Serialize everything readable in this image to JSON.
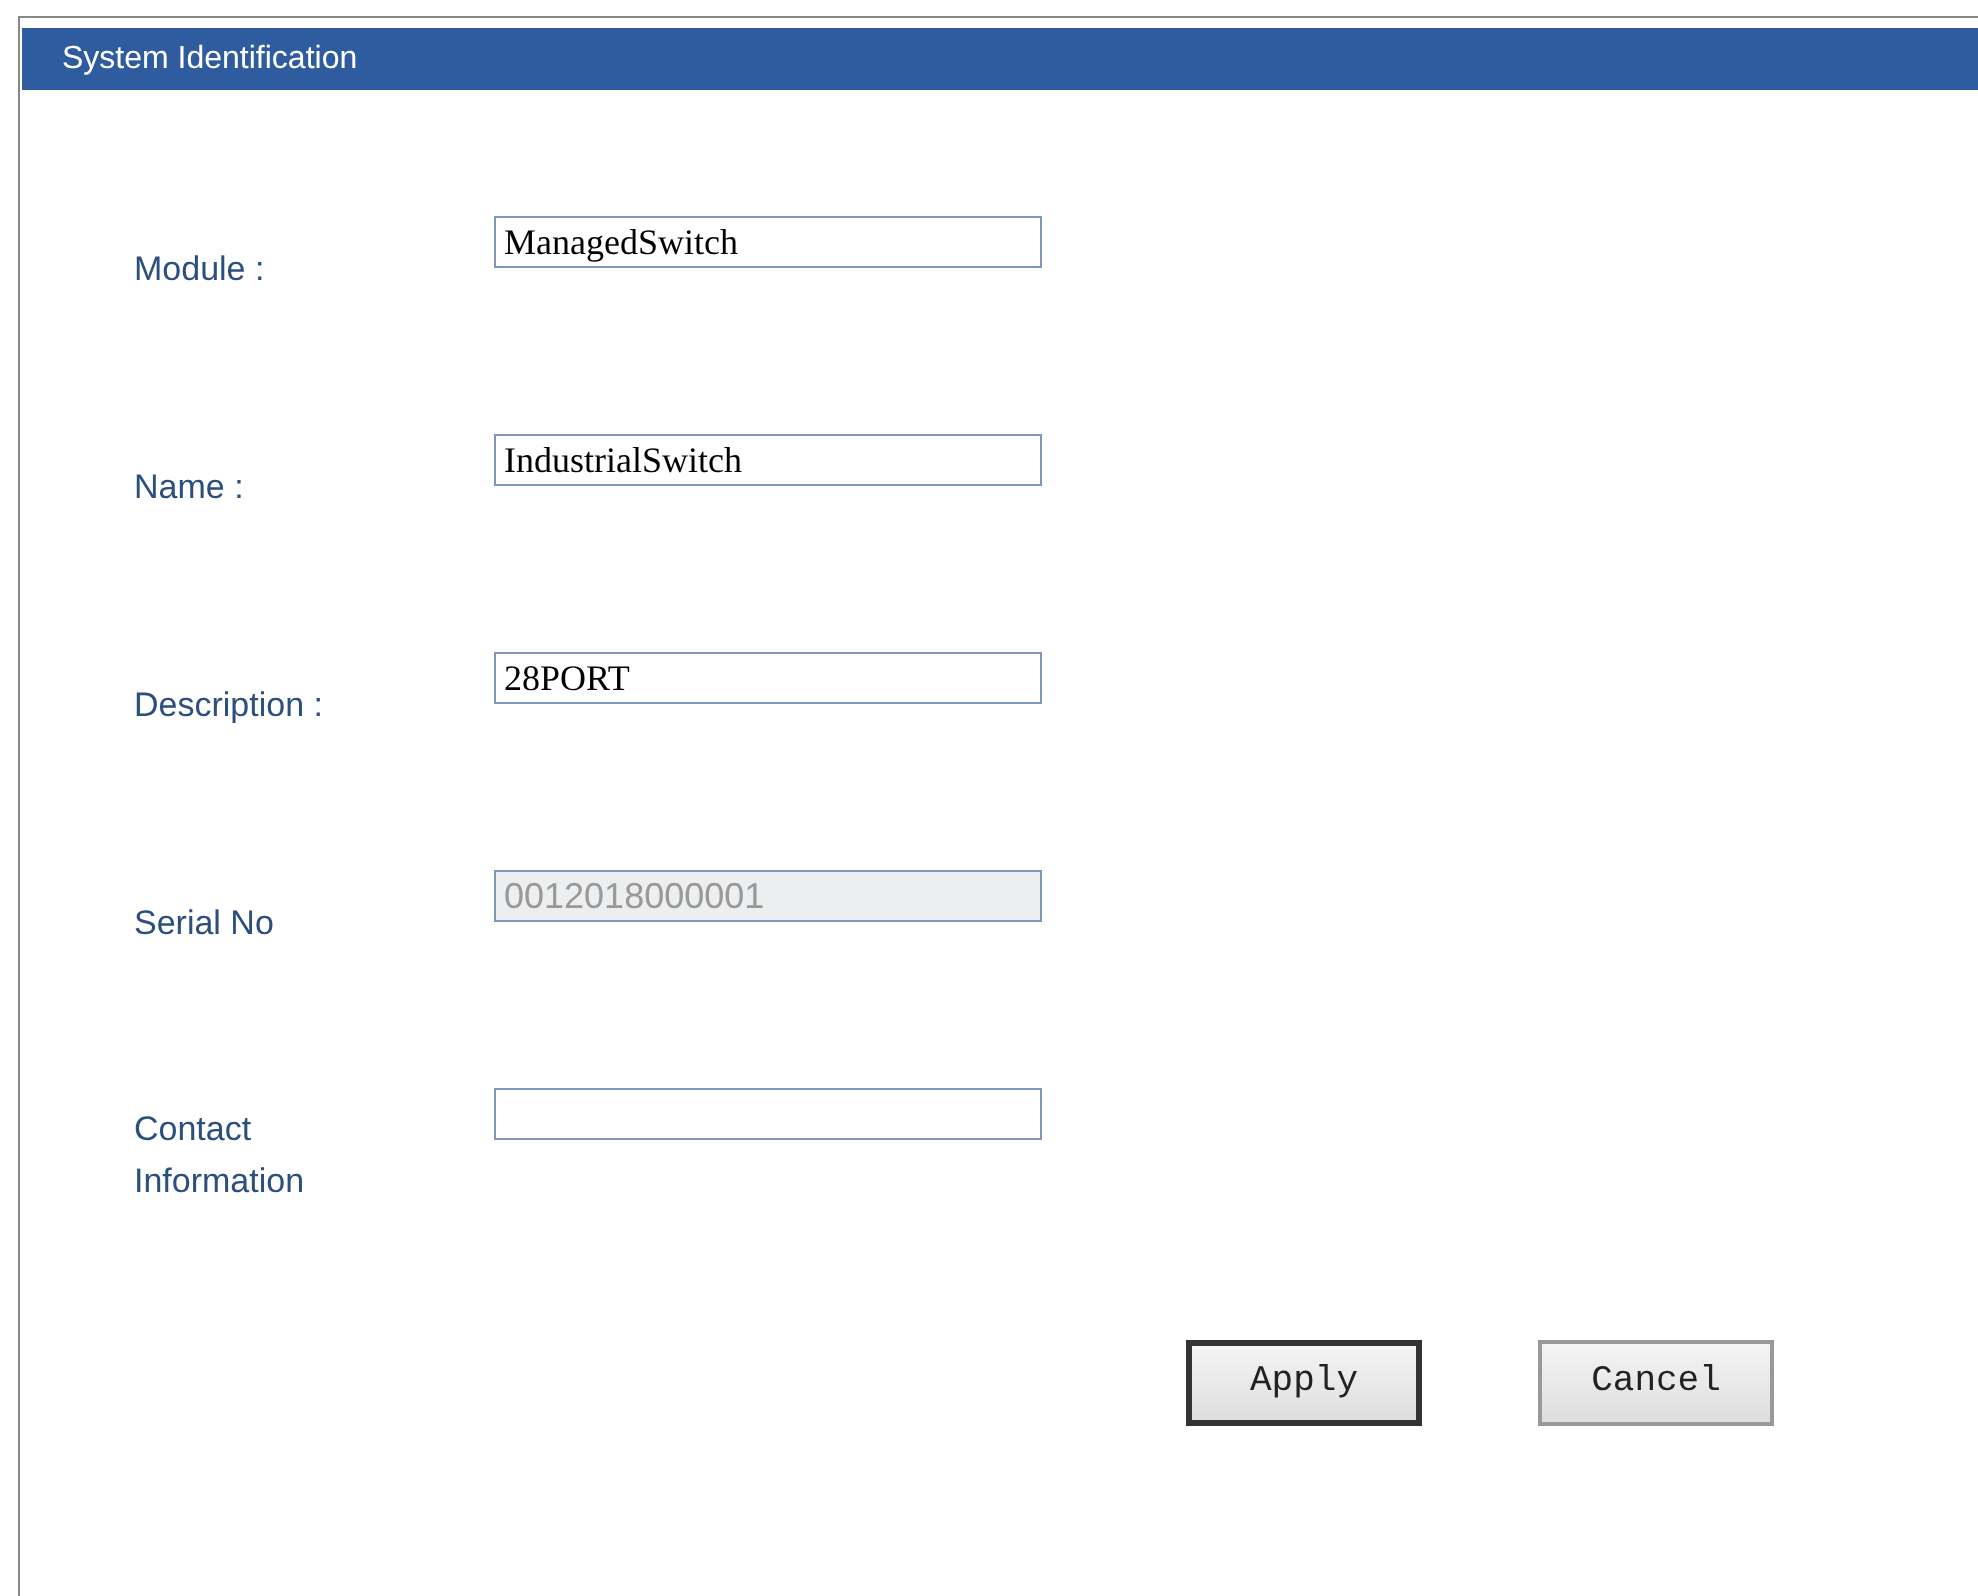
{
  "panel": {
    "title": "System Identification"
  },
  "fields": [
    {
      "label": "Module :",
      "value": "ManagedSwitch",
      "disabled": false
    },
    {
      "label": "Name :",
      "value": "IndustrialSwitch",
      "disabled": false
    },
    {
      "label": "Description :",
      "value": "28PORT",
      "disabled": false
    },
    {
      "label": "Serial No",
      "value": "0012018000001",
      "disabled": true
    },
    {
      "label": "Contact Information",
      "disabled": false
    }
  ],
  "buttons": [
    {
      "label": "Apply",
      "default": true
    },
    {
      "label": "Cancel",
      "default": false
    }
  ]
}
